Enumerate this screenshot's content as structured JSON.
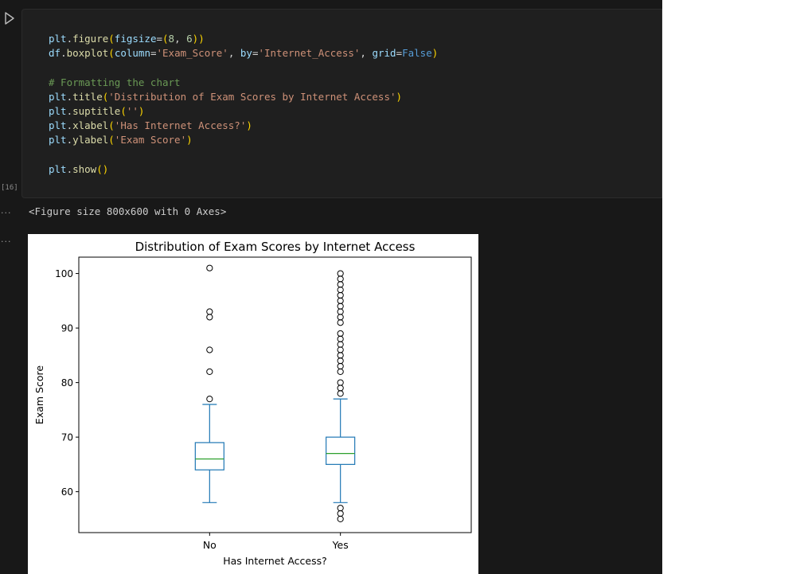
{
  "cell": {
    "execution_count": "[16]",
    "code_lines": [
      [
        {
          "t": "plt",
          "c": "id"
        },
        {
          "t": ".",
          "c": "op"
        },
        {
          "t": "figure",
          "c": "fn"
        },
        {
          "t": "(",
          "c": "paren"
        },
        {
          "t": "figsize",
          "c": "id"
        },
        {
          "t": "=",
          "c": "op"
        },
        {
          "t": "(",
          "c": "paren"
        },
        {
          "t": "8",
          "c": "num"
        },
        {
          "t": ", ",
          "c": "op"
        },
        {
          "t": "6",
          "c": "num"
        },
        {
          "t": ")",
          "c": "paren"
        },
        {
          "t": ")",
          "c": "paren"
        }
      ],
      [
        {
          "t": "df",
          "c": "id"
        },
        {
          "t": ".",
          "c": "op"
        },
        {
          "t": "boxplot",
          "c": "fn"
        },
        {
          "t": "(",
          "c": "paren"
        },
        {
          "t": "column",
          "c": "id"
        },
        {
          "t": "=",
          "c": "op"
        },
        {
          "t": "'Exam_Score'",
          "c": "str"
        },
        {
          "t": ", ",
          "c": "op"
        },
        {
          "t": "by",
          "c": "id"
        },
        {
          "t": "=",
          "c": "op"
        },
        {
          "t": "'Internet_Access'",
          "c": "str"
        },
        {
          "t": ", ",
          "c": "op"
        },
        {
          "t": "grid",
          "c": "id"
        },
        {
          "t": "=",
          "c": "op"
        },
        {
          "t": "False",
          "c": "kw"
        },
        {
          "t": ")",
          "c": "paren"
        }
      ],
      [],
      [
        {
          "t": "# Formatting the chart",
          "c": "cmt"
        }
      ],
      [
        {
          "t": "plt",
          "c": "id"
        },
        {
          "t": ".",
          "c": "op"
        },
        {
          "t": "title",
          "c": "fn"
        },
        {
          "t": "(",
          "c": "paren"
        },
        {
          "t": "'Distribution of Exam Scores by Internet Access'",
          "c": "str"
        },
        {
          "t": ")",
          "c": "paren"
        }
      ],
      [
        {
          "t": "plt",
          "c": "id"
        },
        {
          "t": ".",
          "c": "op"
        },
        {
          "t": "suptitle",
          "c": "fn"
        },
        {
          "t": "(",
          "c": "paren"
        },
        {
          "t": "''",
          "c": "str"
        },
        {
          "t": ")",
          "c": "paren"
        }
      ],
      [
        {
          "t": "plt",
          "c": "id"
        },
        {
          "t": ".",
          "c": "op"
        },
        {
          "t": "xlabel",
          "c": "fn"
        },
        {
          "t": "(",
          "c": "paren"
        },
        {
          "t": "'Has Internet Access?'",
          "c": "str"
        },
        {
          "t": ")",
          "c": "paren"
        }
      ],
      [
        {
          "t": "plt",
          "c": "id"
        },
        {
          "t": ".",
          "c": "op"
        },
        {
          "t": "ylabel",
          "c": "fn"
        },
        {
          "t": "(",
          "c": "paren"
        },
        {
          "t": "'Exam Score'",
          "c": "str"
        },
        {
          "t": ")",
          "c": "paren"
        }
      ],
      [],
      [
        {
          "t": "plt",
          "c": "id"
        },
        {
          "t": ".",
          "c": "op"
        },
        {
          "t": "show",
          "c": "fn"
        },
        {
          "t": "(",
          "c": "paren"
        },
        {
          "t": ")",
          "c": "paren"
        }
      ]
    ]
  },
  "outputs": {
    "marker_1": "...",
    "text_output": "<Figure size 800x600 with 0 Axes>",
    "marker_2": "..."
  },
  "chart_data": {
    "type": "box",
    "title": "Distribution of Exam Scores by Internet Access",
    "xlabel": "Has Internet Access?",
    "ylabel": "Exam Score",
    "ylim": [
      52.5,
      103
    ],
    "yticks": [
      60,
      70,
      80,
      90,
      100
    ],
    "grid": false,
    "box_color": "#1f77b4",
    "median_color": "#2ca02c",
    "groups": [
      {
        "category": "No",
        "q1": 64,
        "median": 66,
        "q3": 69,
        "whisker_low": 58,
        "whisker_high": 76,
        "outliers": [
          77,
          82,
          86,
          92,
          93,
          101
        ]
      },
      {
        "category": "Yes",
        "q1": 65,
        "median": 67,
        "q3": 70,
        "whisker_low": 58,
        "whisker_high": 77,
        "outliers": [
          55,
          56,
          57,
          78,
          79,
          80,
          82,
          83,
          84,
          85,
          86,
          87,
          88,
          89,
          91,
          92,
          93,
          94,
          95,
          96,
          97,
          98,
          99,
          100
        ]
      }
    ]
  }
}
